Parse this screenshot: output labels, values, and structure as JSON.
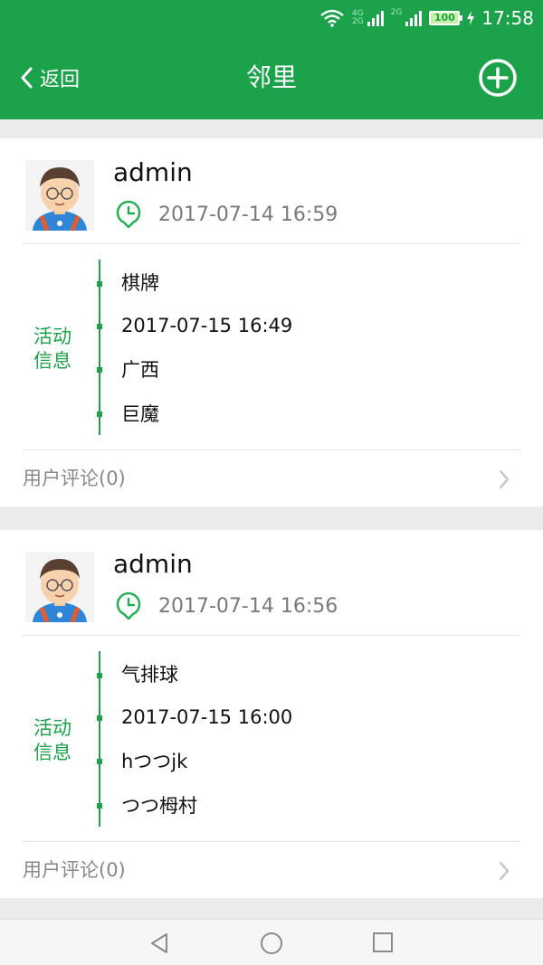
{
  "status_bar": {
    "network_top": "4G",
    "network_bottom": "2G",
    "network_secondary": "2G",
    "battery": "100",
    "time": "17:58"
  },
  "header": {
    "back_label": "返回",
    "title": "邻里",
    "add_icon": "plus-circle-icon"
  },
  "posts": [
    {
      "user": "admin",
      "posted_at": "2017-07-14 16:59",
      "activity_label": "活动信息",
      "details": [
        "棋牌",
        "2017-07-15 16:49",
        "广西",
        "巨魔"
      ],
      "comments": "用户评论(0)"
    },
    {
      "user": "admin",
      "posted_at": "2017-07-14 16:56",
      "activity_label": "活动信息",
      "details": [
        "气排球",
        "2017-07-15 16:00",
        "hつつjk",
        "つつ栂村"
      ],
      "comments": "用户评论(0)"
    }
  ],
  "theme": {
    "primary": "#1ba24a",
    "background": "#ebebeb"
  }
}
